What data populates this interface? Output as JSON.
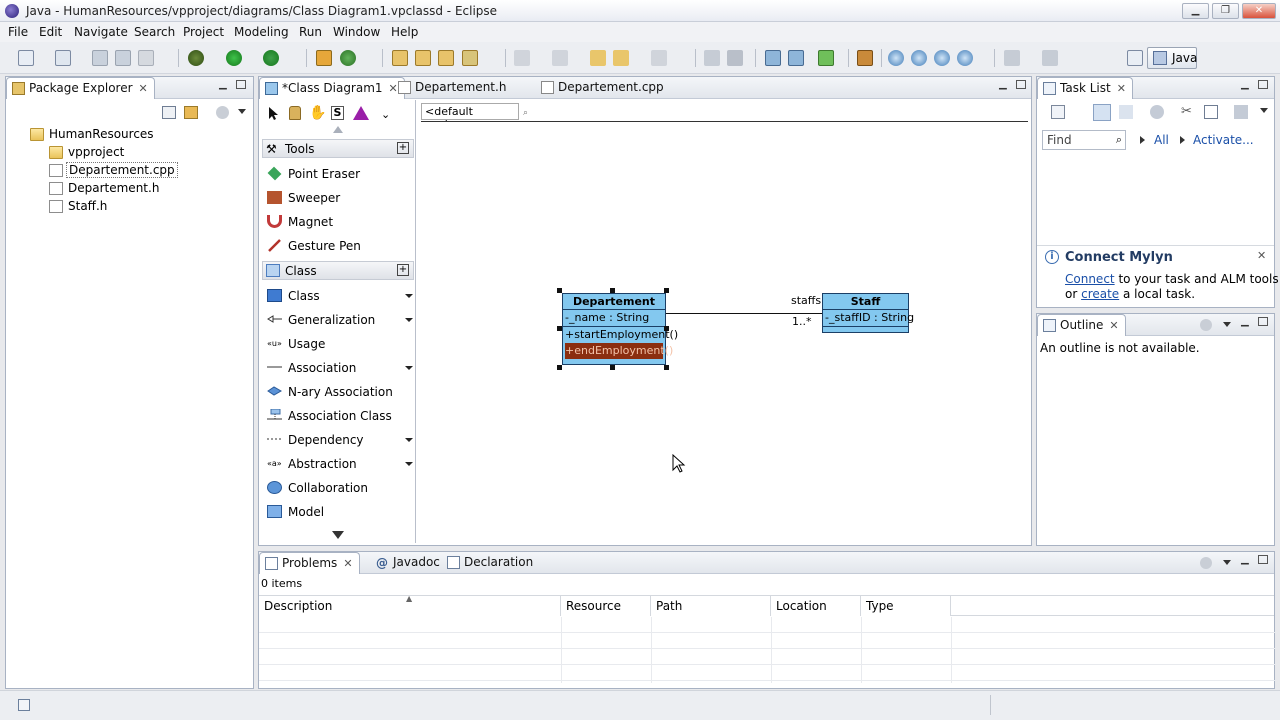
{
  "window": {
    "title": "Java - HumanResources/vpproject/diagrams/Class Diagram1.vpclassd - Eclipse",
    "minimize": "▁",
    "maximize": "❐",
    "close": "✕"
  },
  "menu": [
    "File",
    "Edit",
    "Navigate",
    "Search",
    "Project",
    "Modeling",
    "Run",
    "Window",
    "Help"
  ],
  "toolbar": {
    "perspective": "Java"
  },
  "package_explorer": {
    "title": "Package Explorer",
    "tree": [
      {
        "label": "HumanResources",
        "icon": "project-folder-icon"
      },
      {
        "label": "vpproject",
        "icon": "folder-icon"
      },
      {
        "label": "Departement.cpp",
        "icon": "file-icon"
      },
      {
        "label": "Departement.h",
        "icon": "file-icon"
      },
      {
        "label": "Staff.h",
        "icon": "file-icon"
      }
    ]
  },
  "editor": {
    "tabs": [
      {
        "label": "*Class Diagram1",
        "active": true
      },
      {
        "label": "Departement.h",
        "active": false
      },
      {
        "label": "Departement.cpp",
        "active": false
      }
    ],
    "breadcrumb": "<default package>",
    "palette": {
      "tools_header": "Tools",
      "tools": [
        "Point Eraser",
        "Sweeper",
        "Magnet",
        "Gesture Pen"
      ],
      "class_header": "Class",
      "class_items": [
        "Class",
        "Generalization",
        "Usage",
        "Association",
        "N-ary Association",
        "Association Class",
        "Dependency",
        "Abstraction",
        "Collaboration",
        "Model"
      ],
      "toolbar_glyph_s": "S"
    },
    "diagram": {
      "departement": {
        "name": "Departement",
        "attribute": "-_name : String",
        "operations": [
          "+startEmployment()",
          "+endEmployment()"
        ]
      },
      "staff": {
        "name": "Staff",
        "attribute": "-_staffID : String"
      },
      "association": {
        "role": "staffs",
        "multiplicity": "1..*"
      }
    }
  },
  "task_list": {
    "title": "Task List",
    "find_placeholder": "Find",
    "all": "All",
    "activate": "Activate..."
  },
  "mylyn": {
    "title": "Connect Mylyn",
    "connect": "Connect",
    "text1": " to your task and ALM tools",
    "or": "or ",
    "create": "create",
    "text2": " a local task."
  },
  "outline": {
    "title": "Outline",
    "message": "An outline is not available."
  },
  "bottom": {
    "tabs": [
      "Problems",
      "Javadoc",
      "Declaration"
    ],
    "javadoc_glyph": "@",
    "count": "0 items",
    "columns": [
      "Description",
      "Resource",
      "Path",
      "Location",
      "Type"
    ]
  },
  "colors": {
    "uml_fill": "#83c8ef",
    "uml_border": "#1b3f66",
    "selected_op": "#8b2e10"
  }
}
